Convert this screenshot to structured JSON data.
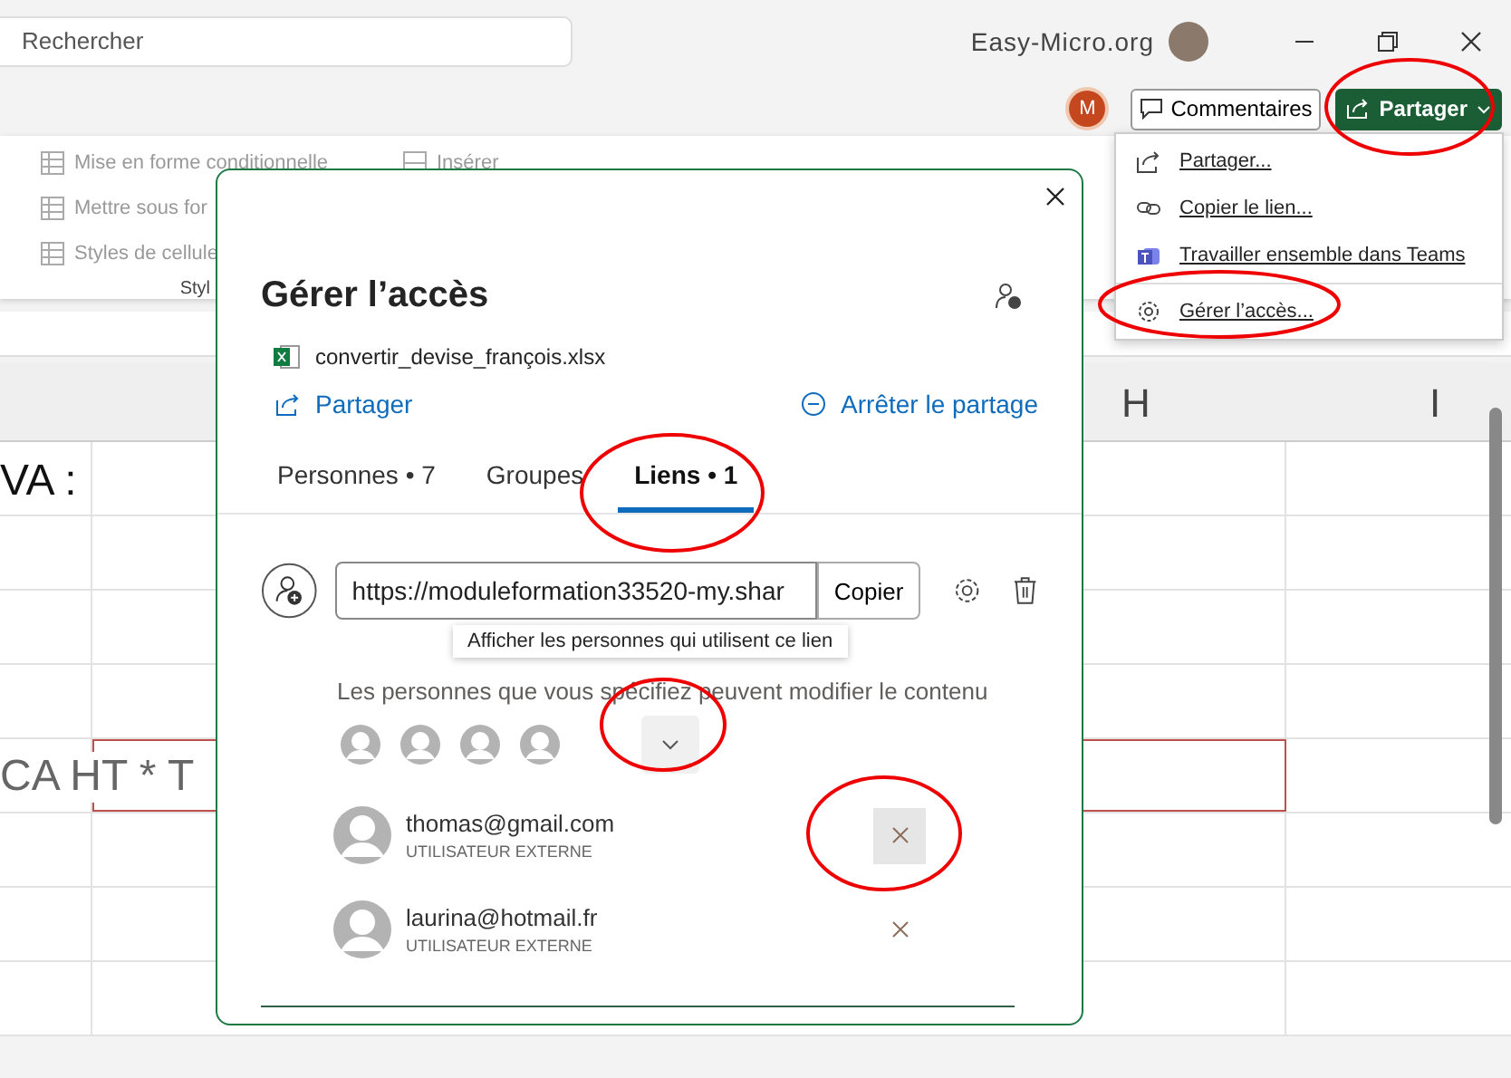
{
  "titlebar": {
    "search_placeholder": "Rechercher",
    "site": "Easy-Micro.org"
  },
  "command_bar": {
    "avatar_initial": "M",
    "comments": "Commentaires",
    "share": "Partager"
  },
  "ribbon": {
    "styles": [
      "Mise en forme conditionnelle",
      "Mettre sous for",
      "Styles de cellule"
    ],
    "group_label": "Styl",
    "insert": "Insérer"
  },
  "sheet": {
    "columns": [
      "H",
      "I"
    ],
    "rows": [
      {
        "cell": "VA :",
        "selected": false
      },
      {
        "selected": false
      },
      {
        "selected": false
      },
      {
        "selected": false
      },
      {
        "cell": "CA HT * T",
        "selected": true
      },
      {
        "selected": false
      },
      {
        "selected": false
      },
      {
        "selected": false
      }
    ]
  },
  "share_menu": {
    "items": [
      {
        "label": "Partager...",
        "kind": "share"
      },
      {
        "label": "Copier le lien...",
        "kind": "link"
      },
      {
        "label": "Travailler ensemble dans Teams",
        "kind": "teams"
      },
      {
        "label": "Gérer l’accès...",
        "kind": "manage"
      }
    ]
  },
  "dialog": {
    "title": "Gérer l’accès",
    "file": "convertir_devise_françois.xlsx",
    "share_link": "Partager",
    "stop_link": "Arrêter le partage",
    "tabs": [
      {
        "label": "Personnes • 7",
        "selected": false
      },
      {
        "label": "Groupes",
        "selected": false
      },
      {
        "label": "Liens • 1",
        "selected": true
      }
    ],
    "link": {
      "url": "https://moduleformation33520-my.shar",
      "copy": "Copier",
      "tooltip": "Afficher les personnes qui utilisent ce lien",
      "description": "Les personnes que vous spécifiez peuvent modifier le contenu"
    },
    "people": [
      {
        "email": "thomas@gmail.com",
        "role": "UTILISATEUR EXTERNE",
        "hovered": true
      },
      {
        "email": "laurina@hotmail.fr",
        "role": "UTILISATEUR EXTERNE",
        "hovered": false
      }
    ]
  }
}
